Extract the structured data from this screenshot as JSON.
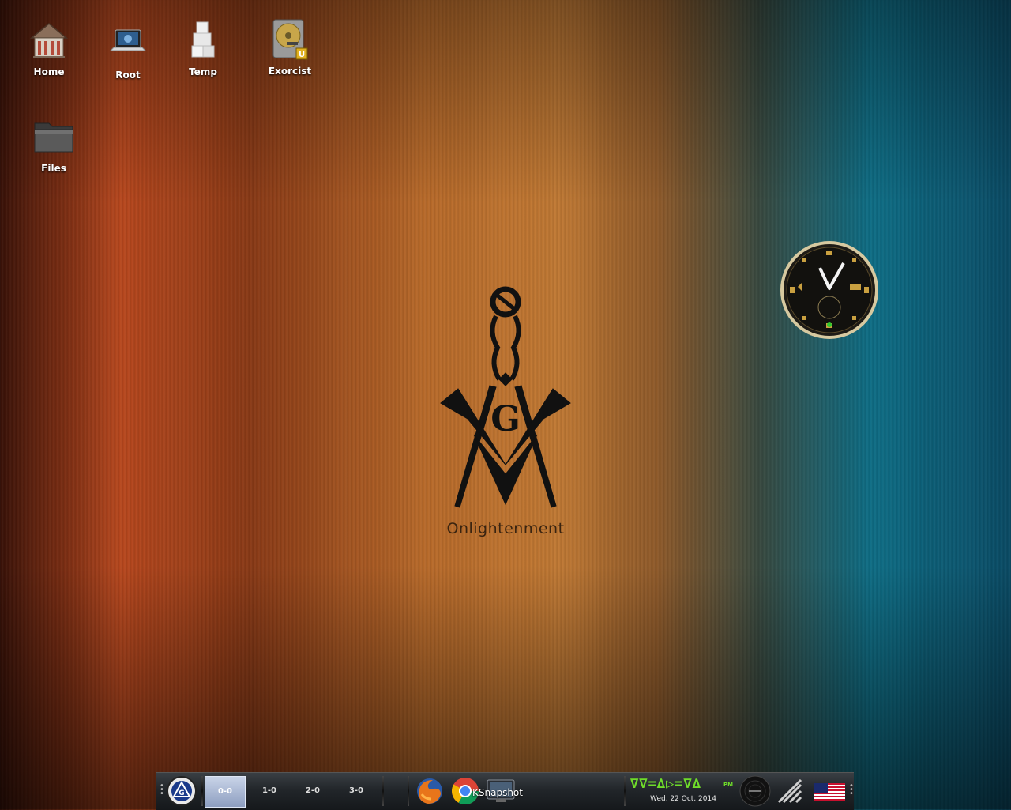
{
  "desktop": {
    "icons": [
      {
        "label": "Home"
      },
      {
        "label": "Root"
      },
      {
        "label": "Temp"
      },
      {
        "label": "Exorcist"
      },
      {
        "label": "Files"
      }
    ],
    "wallpaper_text": "Onlightenment",
    "emblem_letter": "G"
  },
  "taskbar": {
    "pager": [
      "0-0",
      "1-0",
      "2-0",
      "3-0"
    ],
    "tasks": [
      {
        "icon": "firefox-icon"
      },
      {
        "icon": "chrome-icon"
      },
      {
        "icon": "ksnapshot-icon",
        "label": "KSnapshot"
      }
    ],
    "clock_time": "∇∇=∆▷=∇∆",
    "clock_ampm": "PM",
    "clock_date": "Wed, 22 Oct, 2014"
  },
  "colors": {
    "accent_green": "#6fdc2a",
    "taskbar_bg": "#22262a"
  }
}
